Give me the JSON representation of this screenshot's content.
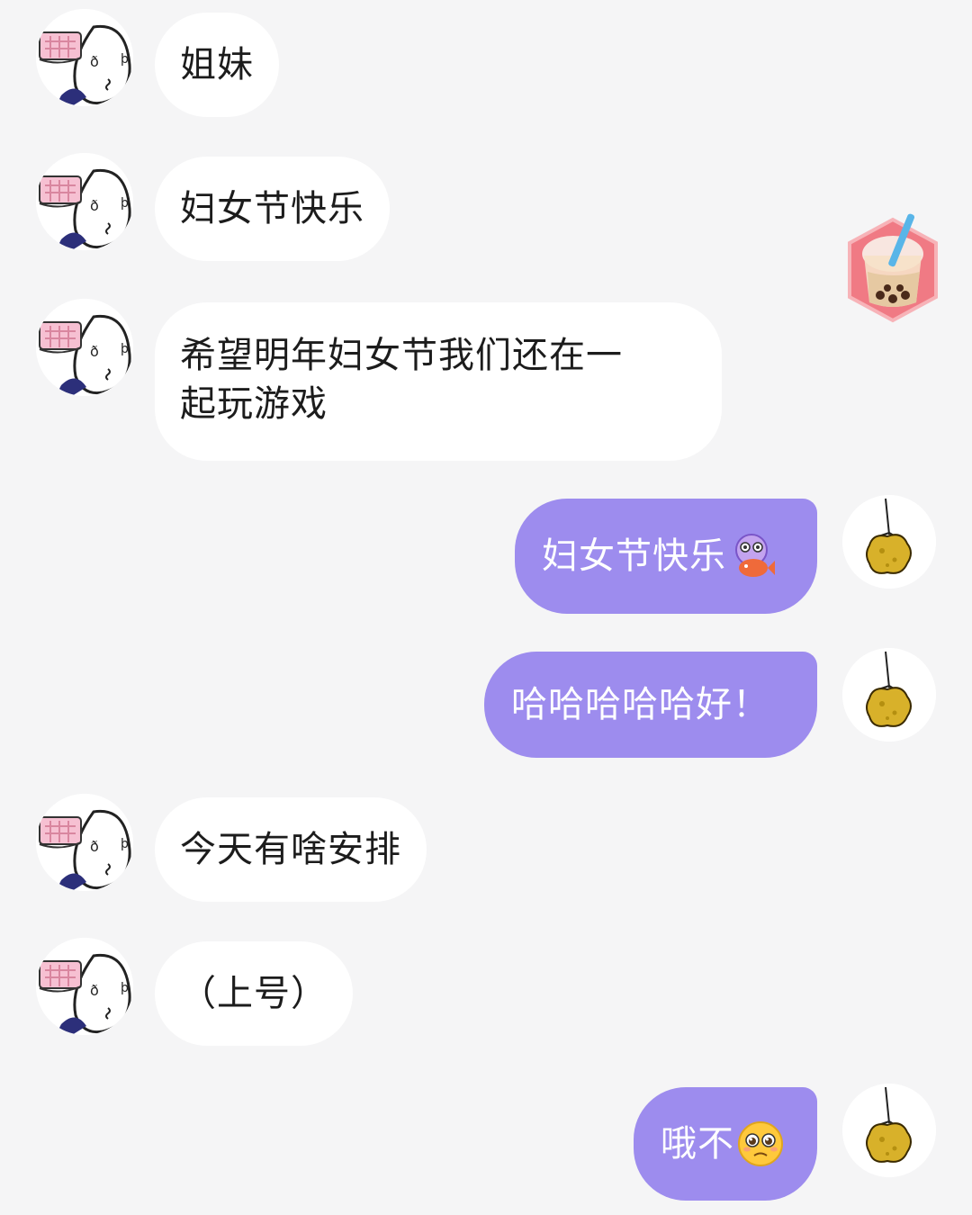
{
  "messages": [
    {
      "side": "in",
      "text": "姐妹"
    },
    {
      "side": "in",
      "text": "妇女节快乐"
    },
    {
      "side": "in",
      "line1": "希望明年妇女节我们还在一",
      "line2": "起玩游戏"
    },
    {
      "side": "out",
      "text": "妇女节快乐",
      "emoji": "octopus-fish-emoji"
    },
    {
      "side": "out",
      "text": "哈哈哈哈哈好！"
    },
    {
      "side": "in",
      "text": "今天有啥安排"
    },
    {
      "side": "in",
      "text": "（上号）"
    },
    {
      "side": "out",
      "text": "哦不",
      "emoji": "pleading-face-emoji"
    }
  ],
  "icons": {
    "contact_avatar": "cartoon-face-avatar-icon",
    "self_avatar": "hanging-sponge-avatar-icon",
    "floating_sticker": "bubble-tea-icon"
  },
  "colors": {
    "background": "#f5f5f6",
    "incoming_bubble": "#ffffff",
    "outgoing_bubble": "#9d8cee"
  }
}
